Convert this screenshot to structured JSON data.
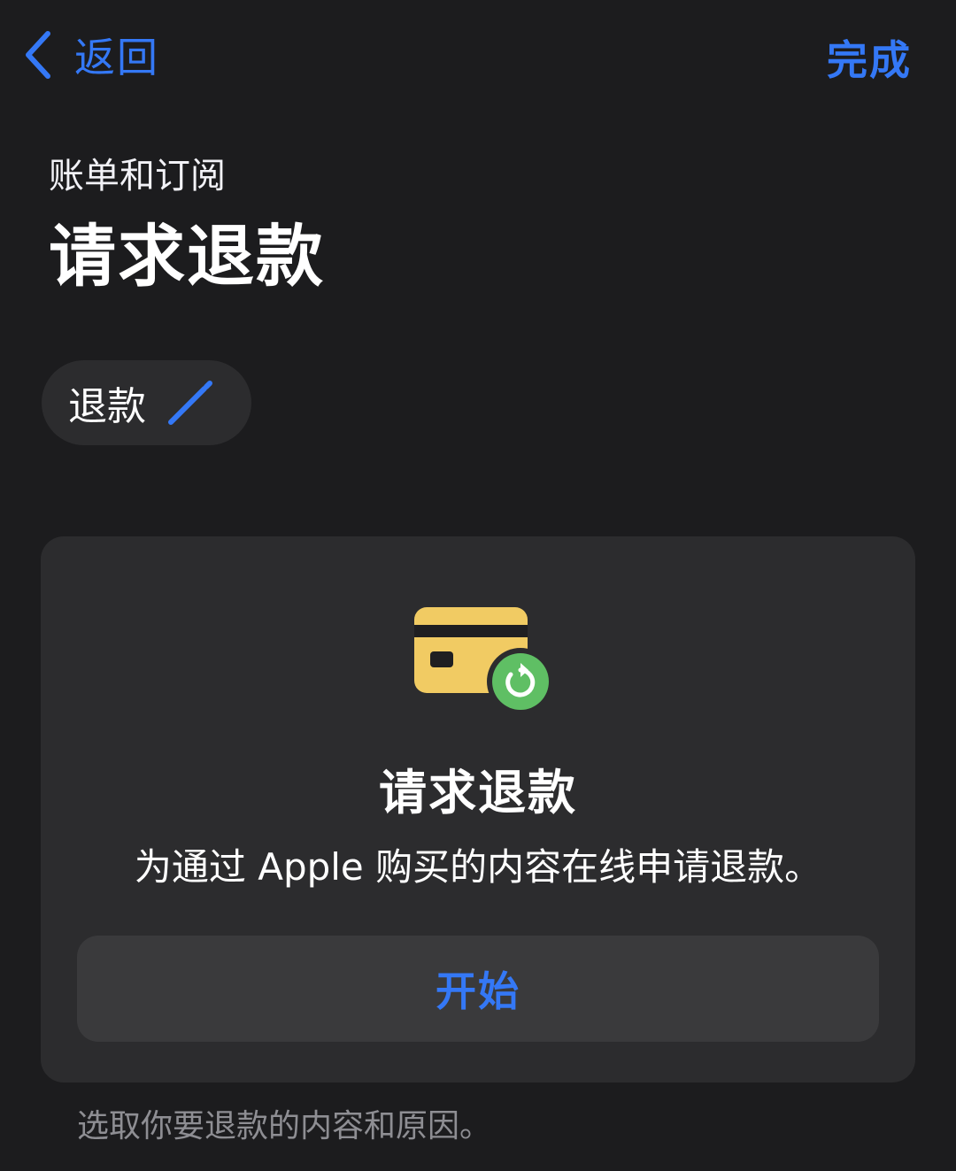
{
  "nav": {
    "back_label": "返回",
    "done_label": "完成"
  },
  "header": {
    "eyebrow": "账单和订阅",
    "title": "请求退款"
  },
  "chip": {
    "label": "退款"
  },
  "card": {
    "title": "请求退款",
    "description": "为通过 Apple 购买的内容在线申请退款。",
    "button_label": "开始"
  },
  "footer": {
    "note": "选取你要退款的内容和原因。"
  },
  "icons": {
    "back": "chevron-left-icon",
    "edit": "pencil-icon",
    "card": "credit-card-refund-icon"
  },
  "colors": {
    "background": "#1c1c1e",
    "surface": "#2c2c2e",
    "button": "#3a3a3c",
    "accent": "#3478f6",
    "card_yellow": "#f1cb63",
    "refund_green": "#5fbf64",
    "secondary_text": "#8e8e93"
  }
}
